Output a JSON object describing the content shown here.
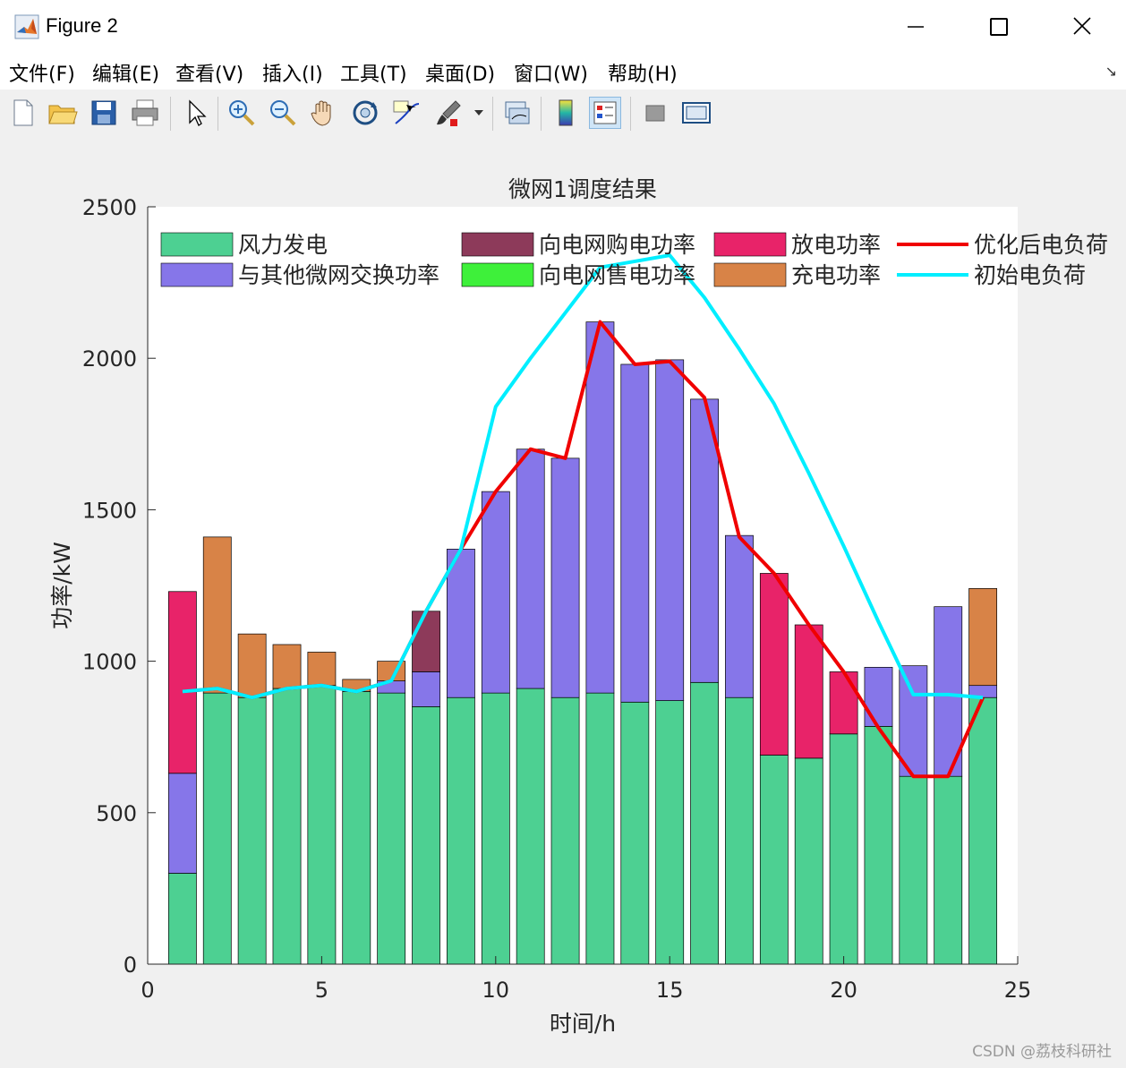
{
  "window": {
    "title": "Figure 2",
    "minimize_glyph": "—",
    "close_glyph": "✕"
  },
  "menu": {
    "items": [
      "文件(F)",
      "编辑(E)",
      "查看(V)",
      "插入(I)",
      "工具(T)",
      "桌面(D)",
      "窗口(W)",
      "帮助(H)"
    ],
    "overflow_glyph": "↘"
  },
  "toolbar": {
    "icons": [
      "new-file-icon",
      "open-folder-icon",
      "save-icon",
      "print-icon",
      "pointer-icon",
      "zoom-in-icon",
      "zoom-out-icon",
      "pan-hand-icon",
      "rotate-3d-icon",
      "data-cursor-icon",
      "brush-icon",
      "link-plot-icon",
      "colorbar-icon",
      "legend-icon",
      "hide-plot-tools-icon",
      "show-plot-tools-icon"
    ]
  },
  "chart_data": {
    "type": "bar",
    "stacked": true,
    "title": "微网1调度结果",
    "xlabel": "时间/h",
    "ylabel": "功率/kW",
    "xlim": [
      0,
      25
    ],
    "ylim": [
      0,
      2500
    ],
    "xticks": [
      0,
      5,
      10,
      15,
      20,
      25
    ],
    "yticks": [
      0,
      500,
      1000,
      1500,
      2000,
      2500
    ],
    "legend_position": "top",
    "grid": false,
    "x": [
      1,
      2,
      3,
      4,
      5,
      6,
      7,
      8,
      9,
      10,
      11,
      12,
      13,
      14,
      15,
      16,
      17,
      18,
      19,
      20,
      21,
      22,
      23,
      24
    ],
    "series": [
      {
        "name": "风力发电",
        "kind": "bar",
        "color": "#4dd092",
        "values": [
          300,
          895,
          880,
          910,
          920,
          900,
          895,
          850,
          880,
          895,
          910,
          880,
          895,
          865,
          870,
          930,
          880,
          690,
          680,
          760,
          785,
          620,
          620,
          880
        ]
      },
      {
        "name": "与其他微网交换功率",
        "kind": "bar",
        "color": "#8676e9",
        "values": [
          330,
          0,
          0,
          0,
          0,
          0,
          40,
          115,
          490,
          665,
          790,
          790,
          1225,
          1115,
          1125,
          935,
          535,
          0,
          0,
          0,
          195,
          365,
          560,
          40
        ]
      },
      {
        "name": "向电网购电功率",
        "kind": "bar",
        "color": "#8d3a5a",
        "values": [
          0,
          0,
          0,
          0,
          0,
          0,
          0,
          200,
          0,
          0,
          0,
          0,
          0,
          0,
          0,
          0,
          0,
          0,
          0,
          0,
          0,
          0,
          0,
          0
        ]
      },
      {
        "name": "向电网售电功率",
        "kind": "bar",
        "color": "#3ef03a",
        "values": [
          0,
          0,
          0,
          0,
          0,
          0,
          0,
          0,
          0,
          0,
          0,
          0,
          0,
          0,
          0,
          0,
          0,
          0,
          0,
          0,
          0,
          0,
          0,
          0
        ]
      },
      {
        "name": "放电功率",
        "kind": "bar",
        "color": "#e82369",
        "values": [
          600,
          0,
          0,
          0,
          0,
          0,
          0,
          0,
          0,
          0,
          0,
          0,
          0,
          0,
          0,
          0,
          0,
          600,
          440,
          205,
          0,
          0,
          0,
          0
        ]
      },
      {
        "name": "充电功率",
        "kind": "bar",
        "color": "#d88347",
        "values": [
          0,
          515,
          210,
          145,
          110,
          40,
          65,
          0,
          0,
          0,
          0,
          0,
          0,
          0,
          0,
          0,
          0,
          0,
          0,
          0,
          0,
          0,
          0,
          320
        ]
      },
      {
        "name": "优化后电负荷",
        "kind": "line",
        "color": "#f00000",
        "values": [
          900,
          910,
          880,
          910,
          920,
          900,
          935,
          1165,
          1370,
          1560,
          1700,
          1670,
          2120,
          1980,
          1990,
          1870,
          1410,
          1290,
          1120,
          965,
          780,
          620,
          620,
          880
        ]
      },
      {
        "name": "初始电负荷",
        "kind": "line",
        "color": "#00eeff",
        "values": [
          900,
          910,
          880,
          910,
          920,
          900,
          935,
          1165,
          1370,
          1840,
          2000,
          2150,
          2300,
          2320,
          2340,
          2200,
          2030,
          1850,
          1620,
          1380,
          1130,
          890,
          890,
          880
        ]
      }
    ]
  },
  "watermark": "CSDN @荔枝科研社"
}
